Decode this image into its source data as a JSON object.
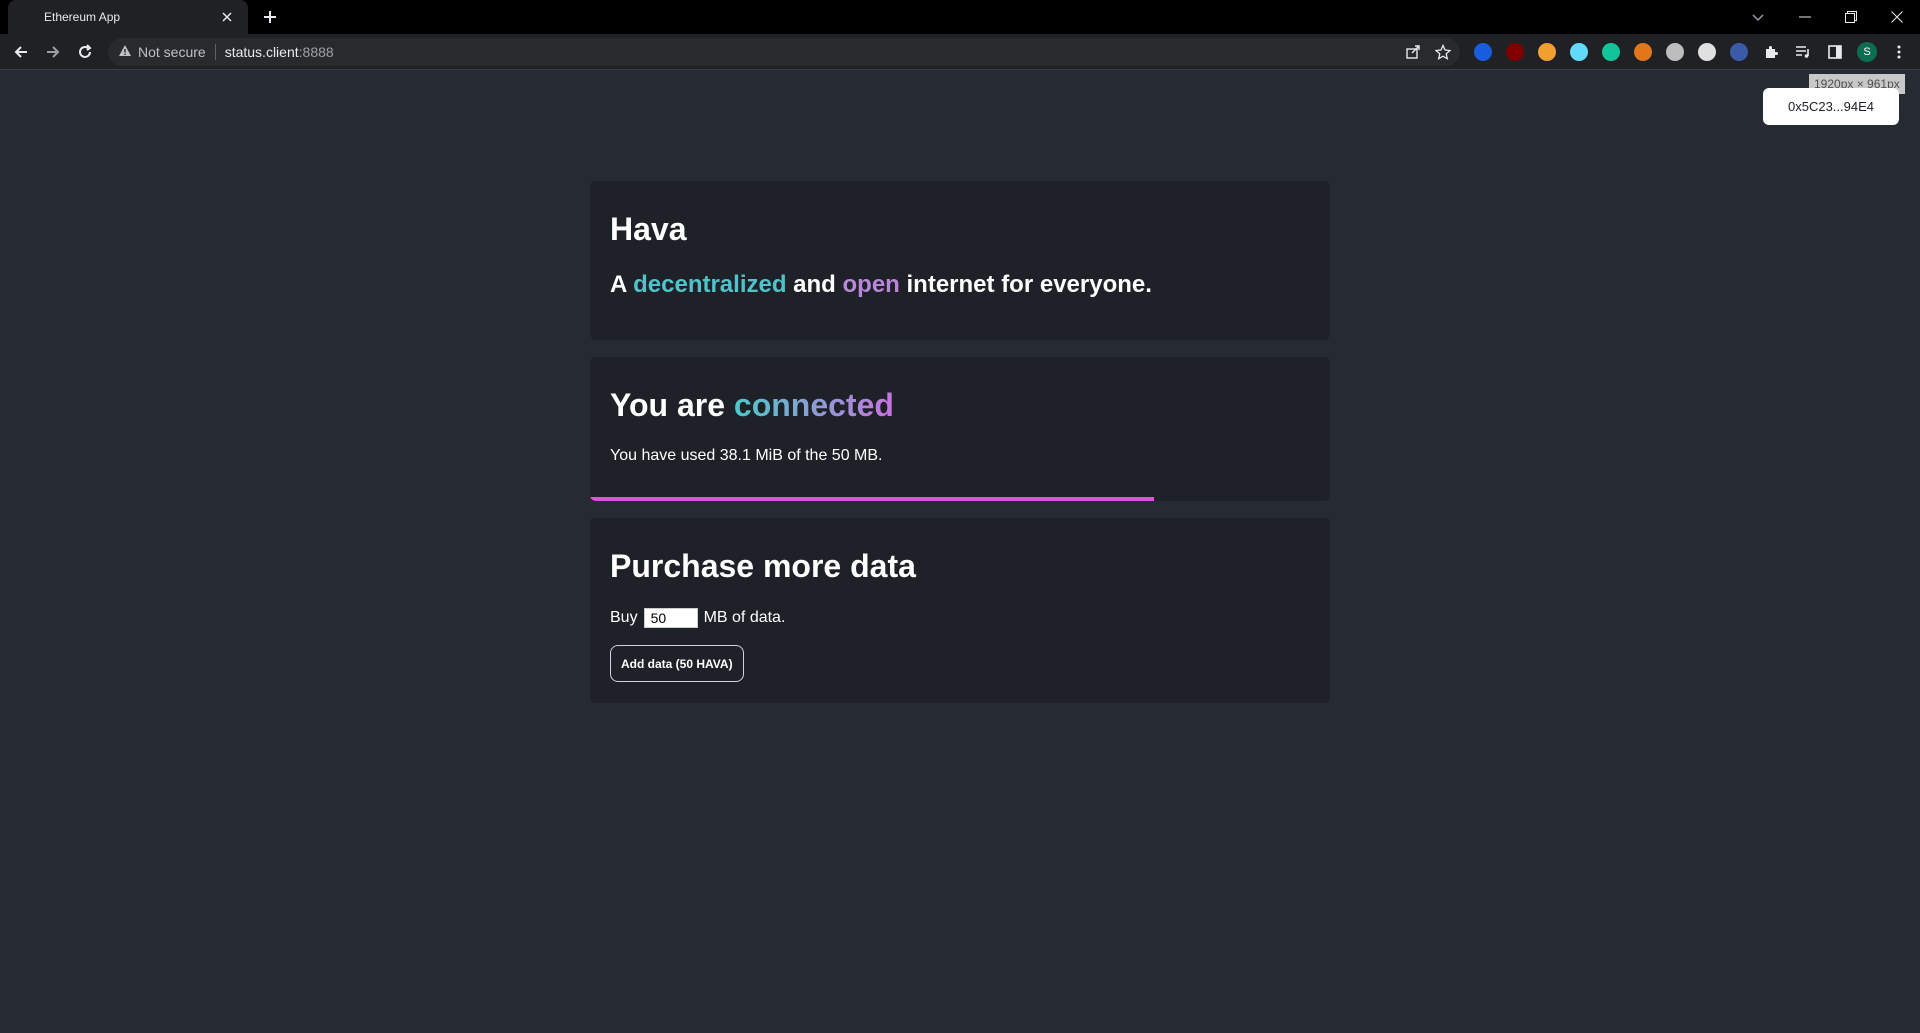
{
  "browser": {
    "tab_title": "Ethereum App",
    "security_label": "Not secure",
    "url_host": "status.client",
    "url_port": ":8888",
    "profile_initial": "S",
    "extensions": [
      {
        "name": "bitwarden-icon",
        "color": "#175ddc"
      },
      {
        "name": "ublock-icon",
        "color": "#800000"
      },
      {
        "name": "cookie-icon",
        "color": "#f0a030"
      },
      {
        "name": "react-devtools-icon",
        "color": "#61dafb"
      },
      {
        "name": "grammarly-icon",
        "color": "#15c39a"
      },
      {
        "name": "metamask-icon",
        "color": "#e2761b"
      },
      {
        "name": "record-icon",
        "color": "#bdbdbd"
      },
      {
        "name": "circle-extension-icon",
        "color": "#e0e0e0"
      },
      {
        "name": "data-extension-icon",
        "color": "#3b5ba9"
      }
    ]
  },
  "overlay": {
    "size_badge": "1920px × 961px",
    "wallet_address": "0x5C23...94E4"
  },
  "intro": {
    "brand": "Hava",
    "tagline_prefix": "A ",
    "tagline_word1": "decentralized",
    "tagline_mid": " and ",
    "tagline_word2": "open",
    "tagline_suffix": " internet for everyone."
  },
  "status": {
    "title_prefix": "You are ",
    "title_state": "connected",
    "usage_text": "You have used 38.1 MiB of the 50 MB.",
    "usage_fraction": 0.762
  },
  "purchase": {
    "title": "Purchase more data",
    "buy_prefix": "Buy",
    "amount": "50",
    "buy_suffix": "MB of data.",
    "button_label": "Add data (50 HAVA)"
  },
  "colors": {
    "background": "#262a33",
    "card": "#1e2127",
    "accent_teal": "#4fc3c9",
    "accent_purple": "#b787d8",
    "progress": "#e04fe0"
  }
}
